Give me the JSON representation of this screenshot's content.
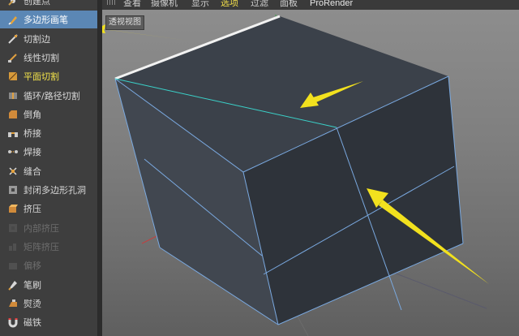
{
  "toolbar": {
    "tools": [
      {
        "label": "创建点",
        "icon": "create-point-icon",
        "state": "normal"
      },
      {
        "label": "多边形画笔",
        "icon": "polygon-pen-icon",
        "state": "active"
      },
      {
        "label": "切割边",
        "icon": "knife-edge-icon",
        "state": "normal"
      },
      {
        "label": "线性切割",
        "icon": "line-cut-icon",
        "state": "normal"
      },
      {
        "label": "平面切割",
        "icon": "plane-cut-icon",
        "state": "highlight"
      },
      {
        "label": "循环/路径切割",
        "icon": "loop-cut-icon",
        "state": "normal"
      },
      {
        "label": "倒角",
        "icon": "bevel-icon",
        "state": "normal"
      },
      {
        "label": "桥接",
        "icon": "bridge-icon",
        "state": "normal"
      },
      {
        "label": "焊接",
        "icon": "weld-icon",
        "state": "normal"
      },
      {
        "label": "缝合",
        "icon": "stitch-icon",
        "state": "normal"
      },
      {
        "label": "封闭多边形孔洞",
        "icon": "close-hole-icon",
        "state": "normal"
      },
      {
        "label": "挤压",
        "icon": "extrude-icon",
        "state": "normal"
      },
      {
        "label": "内部挤压",
        "icon": "extrude-inner-icon",
        "state": "disabled"
      },
      {
        "label": "矩阵挤压",
        "icon": "matrix-extrude-icon",
        "state": "disabled"
      },
      {
        "label": "偏移",
        "icon": "offset-icon",
        "state": "disabled"
      },
      {
        "label": "笔刷",
        "icon": "brush-icon",
        "state": "normal"
      },
      {
        "label": "熨烫",
        "icon": "iron-icon",
        "state": "normal"
      },
      {
        "label": "磁铁",
        "icon": "magnet-icon",
        "state": "normal"
      }
    ]
  },
  "menu": {
    "items": [
      "查看",
      "摄像机",
      "显示",
      "选项",
      "过滤",
      "面板",
      "ProRender"
    ],
    "selected": "选项"
  },
  "viewport": {
    "label": "透视视图"
  },
  "colors": {
    "active_bg": "#5b87b5",
    "highlight_text": "#f2e24a",
    "cube_edge": "#7aa9e0",
    "cut_line": "#3bd0c8",
    "arrow": "#f2e11e"
  }
}
